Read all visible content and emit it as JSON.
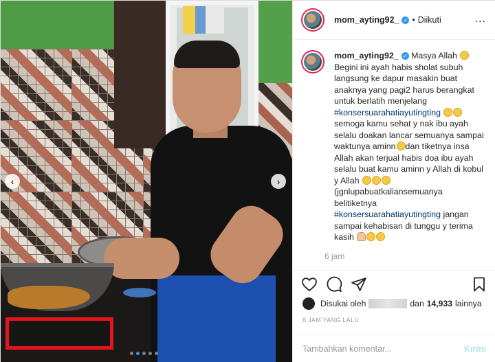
{
  "post": {
    "username": "mom_ayting92_",
    "follow_status": "Diikuti",
    "separator": "•",
    "more_label": "...",
    "verified": true
  },
  "caption": {
    "username": "mom_ayting92_",
    "line1": " Masya Allah ",
    "line2": "Begini ini ayah habis sholat subuh langsung ke dapur masakin buat anaknya yang pagi2 harus berangkat untuk berlatih menjelang ",
    "hashtag1": "#konsersuarahatiayutingting",
    "line3": "semoga kamu sehat y nak ibu ayah selalu doakan lancar semuanya sampai waktunya aminn",
    "line4": "dan tiketnya insa Allah akan terjual habis doa ibu ayah selalu buat kamu aminn y Allah di kobul y Allah ",
    "line5": "(jgnlupabuatkaliansemuanya belitiketnya",
    "hashtag2": "#konsersuarahatiayutingting",
    "line6": " jangan sampai kehabisan di tunggu y terima kasih ",
    "time": "6 jam"
  },
  "likes": {
    "prefix": "Disukai oleh",
    "and": "dan",
    "count": "14,933",
    "suffix": "lainnya"
  },
  "timestamp": "6 JAM YANG LALU",
  "comment": {
    "placeholder": "Tambahkan komentar...",
    "post_label": "Kirim"
  },
  "carousel": {
    "dot_count": 5,
    "active_index": 1
  },
  "colors": {
    "accent": "#3897f0",
    "highlight_box": "#e8141c",
    "hashtag": "#003569"
  },
  "icons": [
    "heart-icon",
    "comment-icon",
    "share-icon",
    "bookmark-icon",
    "chevron-left-icon",
    "chevron-right-icon",
    "verified-icon",
    "more-icon"
  ]
}
